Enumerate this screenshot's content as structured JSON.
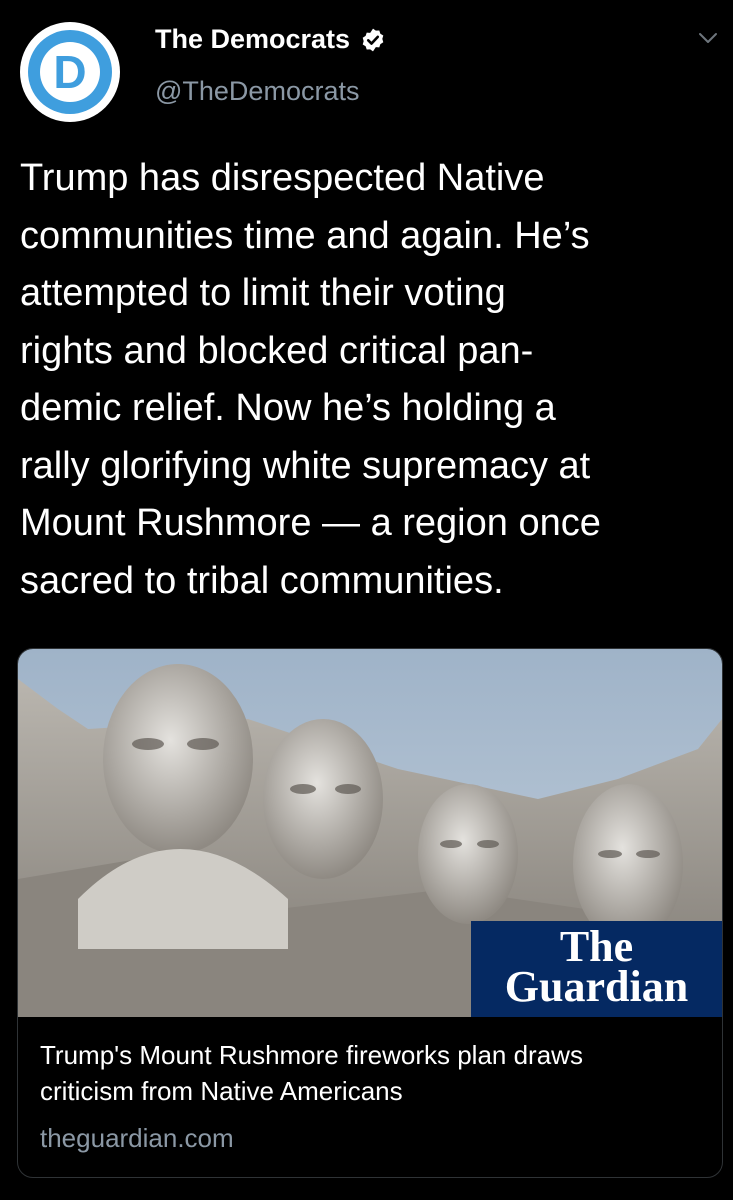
{
  "tweet": {
    "author": {
      "name": "The Democrats",
      "handle": "@TheDemocrats",
      "avatar_letter": "D",
      "verified": true
    },
    "text": "Trump has disrespected Native\ncommunities time and again. He’s\nattempted to limit their voting\nrights and blocked critical pan-\ndemic relief. Now he’s holding a\nrally glorifying white supremacy at\nMount Rushmore — a region once\nsacred to tribal communities.",
    "card": {
      "image_subject": "Mount Rushmore",
      "logo_line1": "The",
      "logo_line2": "Guardian",
      "title": "Trump's Mount Rushmore fireworks plan draws\ncriticism from Native Americans",
      "domain": "theguardian.com"
    }
  },
  "colors": {
    "background": "#000000",
    "text": "#ffffff",
    "secondary_text": "#8b98a5",
    "verified_badge": "#ffffff",
    "avatar_blue": "#3f9ede",
    "guardian_blue": "#052962"
  },
  "icons": [
    "verified-badge-icon",
    "chevron-down-icon"
  ]
}
